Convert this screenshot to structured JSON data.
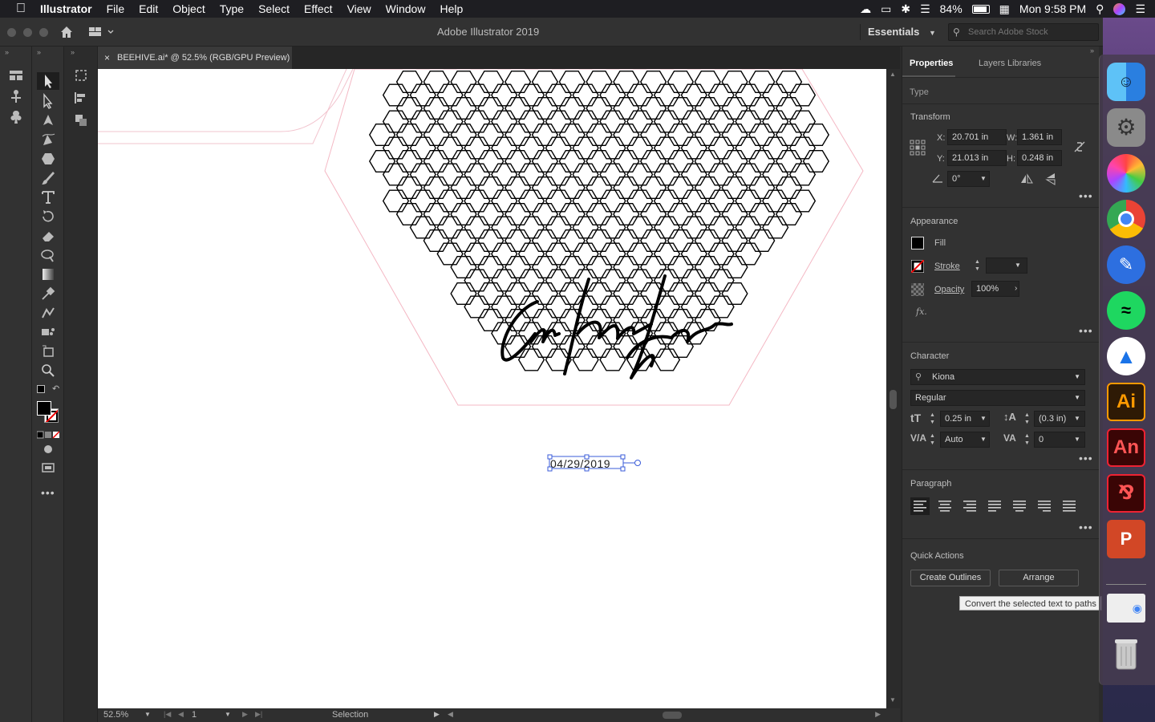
{
  "menubar": {
    "items": [
      "Illustrator",
      "File",
      "Edit",
      "Object",
      "Type",
      "Select",
      "Effect",
      "View",
      "Window",
      "Help"
    ],
    "battery": "84%",
    "clock": "Mon 9:58 PM"
  },
  "appbar": {
    "title": "Adobe Illustrator 2019",
    "workspace": "Essentials",
    "search_placeholder": "Search Adobe Stock"
  },
  "document": {
    "tab_title": "BEEHIVE.ai* @ 52.5% (RGB/GPU Preview)",
    "date_text": "04/29/2019"
  },
  "status": {
    "zoom": "52.5%",
    "page": "1",
    "tool": "Selection"
  },
  "panel": {
    "tabs": [
      "Properties",
      "Layers",
      "Libraries"
    ],
    "type_label": "Type",
    "transform": {
      "title": "Transform",
      "x_label": "X:",
      "x": "20.701 in",
      "y_label": "Y:",
      "y": "21.013 in",
      "w_label": "W:",
      "w": "1.361 in",
      "h_label": "H:",
      "h": "0.248 in",
      "angle": "0°"
    },
    "appearance": {
      "title": "Appearance",
      "fill": "Fill",
      "stroke": "Stroke",
      "opacity_label": "Opacity",
      "opacity": "100%",
      "fx": "fx."
    },
    "character": {
      "title": "Character",
      "font": "Kiona",
      "style": "Regular",
      "size": "0.25 in",
      "leading": "(0.3 in)",
      "kerning": "Auto",
      "tracking": "0"
    },
    "paragraph": {
      "title": "Paragraph"
    },
    "quick_actions": {
      "title": "Quick Actions",
      "create_outlines": "Create Outlines",
      "arrange": "Arrange"
    },
    "tooltip": "Convert the selected text to paths"
  },
  "dock": {
    "apps": [
      "Finder",
      "System Preferences",
      "Photos",
      "Chrome",
      "Pencil",
      "Spotify",
      "Navigation",
      "Ai",
      "An",
      "Acrobat",
      "P",
      "Preview",
      "Trash"
    ]
  },
  "colors": {
    "ui_dark": "#323232",
    "selection_blue": "#3a5bd9",
    "artboard_guide": "#f4b8c4"
  }
}
